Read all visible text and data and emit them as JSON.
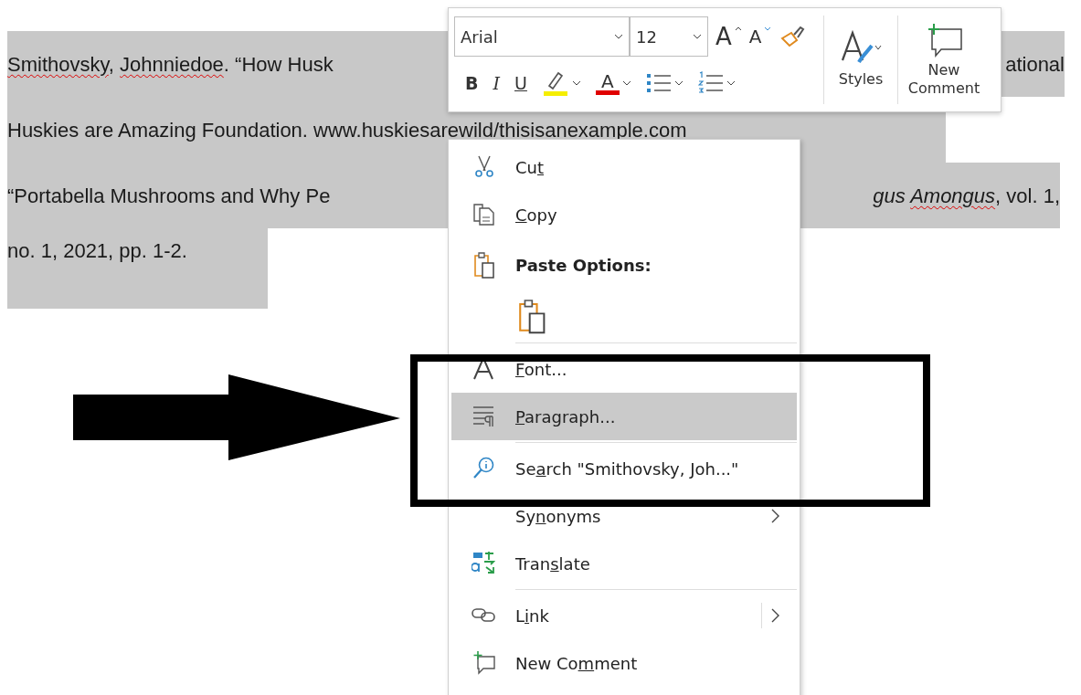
{
  "document": {
    "lines": [
      {
        "selected": true,
        "left": [
          {
            "text": "Smithovsky",
            "misspelled": true
          },
          {
            "text": ", "
          },
          {
            "text": "Johnniedoe",
            "misspelled": true
          },
          {
            "text": ". “How Husk"
          }
        ],
        "right": [
          {
            "text": "ational"
          }
        ]
      },
      {
        "selected": true,
        "left": [
          {
            "text": "Huskies are Amazing Foundation. www.huskiesarewild/thisisanexample.com"
          }
        ]
      },
      {
        "selected": true,
        "left": [
          {
            "text": "“Portabella Mushrooms and Why Pe"
          }
        ],
        "right": [
          {
            "text": "gus ",
            "italic": true
          },
          {
            "text": "Amongus",
            "italic": true,
            "misspelled": true
          },
          {
            "text": ", vol. 1,"
          }
        ]
      },
      {
        "selected": true,
        "left": [
          {
            "text": "no. 1, 2021, pp. 1-2."
          }
        ]
      }
    ]
  },
  "mini_toolbar": {
    "font_name": "Arial",
    "font_size": "12",
    "size_buttons": [
      {
        "kind": "grow",
        "label": "A"
      },
      {
        "kind": "shrink",
        "label": "A"
      }
    ],
    "formatting": [
      {
        "kind": "bold",
        "label": "B"
      },
      {
        "kind": "italic",
        "label": "I"
      },
      {
        "kind": "underline",
        "label": "U"
      },
      {
        "kind": "highlight",
        "color": "#f5ee00"
      },
      {
        "kind": "font_color",
        "label": "A",
        "color": "#e00000"
      },
      {
        "kind": "bullets"
      },
      {
        "kind": "numbering"
      }
    ],
    "styles_label": "Styles",
    "new_comment_label": "New Comment"
  },
  "context_menu": {
    "items": [
      {
        "kind": "command",
        "before": "Cu",
        "key": "t",
        "selected": false,
        "has_submenu": false
      },
      {
        "kind": "command",
        "key": "C",
        "after": "opy",
        "selected": false,
        "has_submenu": false
      },
      {
        "kind": "heading",
        "text": "Paste Options:"
      },
      {
        "kind": "paste_option"
      },
      {
        "kind": "separator"
      },
      {
        "kind": "command",
        "key": "F",
        "after": "ont...",
        "selected": false,
        "has_submenu": false
      },
      {
        "kind": "command",
        "key": "P",
        "after": "aragraph...",
        "selected": true,
        "has_submenu": false
      },
      {
        "kind": "separator"
      },
      {
        "kind": "command",
        "before": "Se",
        "key": "a",
        "after": "rch \"Smithovsky, Joh...\"",
        "selected": false,
        "has_submenu": false
      },
      {
        "kind": "command",
        "before": "Sy",
        "key": "n",
        "after": "onyms",
        "selected": false,
        "has_submenu": true
      },
      {
        "kind": "command",
        "before": "Tran",
        "key": "s",
        "after": "late",
        "selected": false,
        "has_submenu": false
      },
      {
        "kind": "separator"
      },
      {
        "kind": "split_command",
        "before": "L",
        "key": "i",
        "after": "nk",
        "selected": false,
        "has_submenu": true
      },
      {
        "kind": "command",
        "before": "New Co",
        "key": "m",
        "after": "ment",
        "selected": false,
        "has_submenu": false
      }
    ]
  }
}
